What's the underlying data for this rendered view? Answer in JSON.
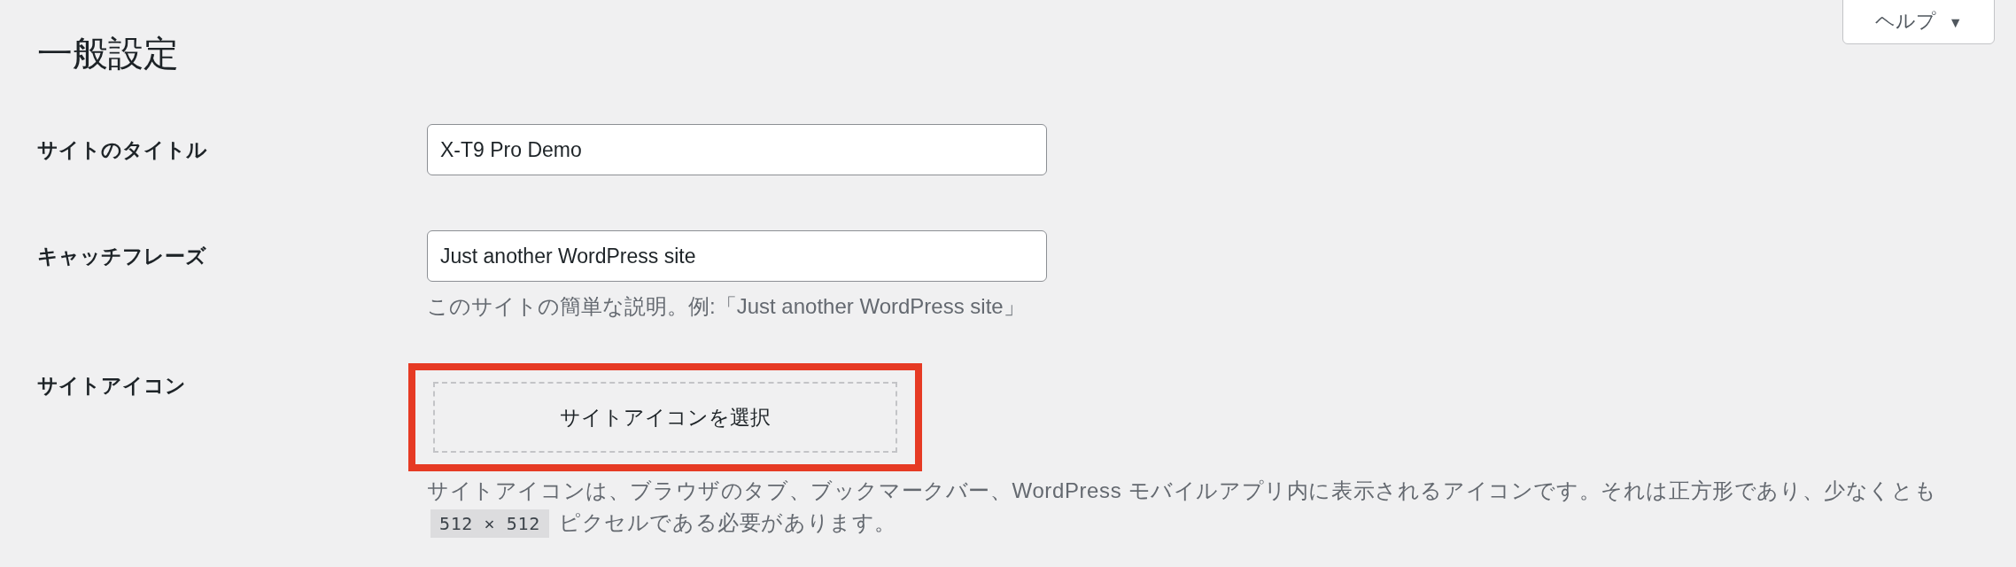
{
  "help_button": {
    "label": "ヘルプ",
    "caret": "▼"
  },
  "title": "一般設定",
  "fields": [
    {
      "kind": "text",
      "label": "サイトのタイトル",
      "value": "X-T9 Pro Demo"
    },
    {
      "kind": "text",
      "label": "キャッチフレーズ",
      "value": "Just another WordPress site",
      "description": "このサイトの簡単な説明。例:「Just another WordPress site」"
    },
    {
      "kind": "icon",
      "label": "サイトアイコン",
      "button": "サイトアイコンを選択",
      "highlighted": true,
      "description_before": "サイトアイコンは、ブラウザのタブ、ブックマークバー、WordPress モバイルアプリ内に表示されるアイコンです。それは正方形であり、少なくとも",
      "description_code": "512 × 512",
      "description_after": "ピクセルである必要があります。"
    }
  ]
}
